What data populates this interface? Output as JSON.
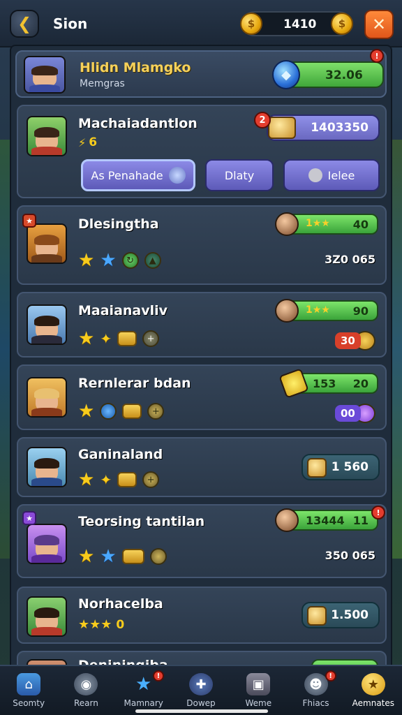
{
  "header": {
    "title": "Sion",
    "coins": "1410",
    "back_icon": "back-arrow-icon",
    "close_icon": "close-x-icon"
  },
  "profile": {
    "name": "Hlidn Mlamgko",
    "subtitle": "Memgras",
    "gems": "32.06",
    "notification": "!"
  },
  "featured": {
    "name": "Machaiadantlon",
    "level_text": "6",
    "currency": "1403350",
    "notification": "2",
    "buttons": [
      {
        "label": "As Penahade"
      },
      {
        "label": "Dlaty"
      },
      {
        "label": "Ielee"
      }
    ]
  },
  "players": [
    {
      "name": "Dlesingtha",
      "pill_value": "40",
      "pill_stars": "1",
      "right_text": "3Z0  065"
    },
    {
      "name": "Maaianavliv",
      "pill_value": "90",
      "pill_stars": "1",
      "badge": "30"
    },
    {
      "name": "Rernlerar bdan",
      "pill_value": "20",
      "pill_prefix": "153",
      "badge": "00"
    },
    {
      "name": "Ganinaland",
      "blue_value": "1 560"
    },
    {
      "name": "Teorsing tantilan",
      "pill_value": "11",
      "pill_prefix": "13444",
      "right_text": "350  065",
      "notification": "!"
    },
    {
      "name": "Norhacelba",
      "blue_value": "1.500",
      "level_text": "0"
    },
    {
      "name": "Deninjngiba"
    }
  ],
  "nav": [
    {
      "label": "Seomty",
      "icon": "home-icon"
    },
    {
      "label": "Rearn",
      "icon": "helmet-icon"
    },
    {
      "label": "Mamnary",
      "icon": "star-icon",
      "notification": "!"
    },
    {
      "label": "Dowep",
      "icon": "dpad-icon"
    },
    {
      "label": "Weme",
      "icon": "map-icon"
    },
    {
      "label": "Fhiacs",
      "icon": "friends-icon",
      "notification": "!"
    },
    {
      "label": "Aemnates",
      "icon": "trophy-icon",
      "active": true
    }
  ],
  "colors": {
    "accent_green": "#4fbf45",
    "button_purple": "#7270d0",
    "gold": "#f6d15a",
    "alert_red": "#e43d2e"
  }
}
